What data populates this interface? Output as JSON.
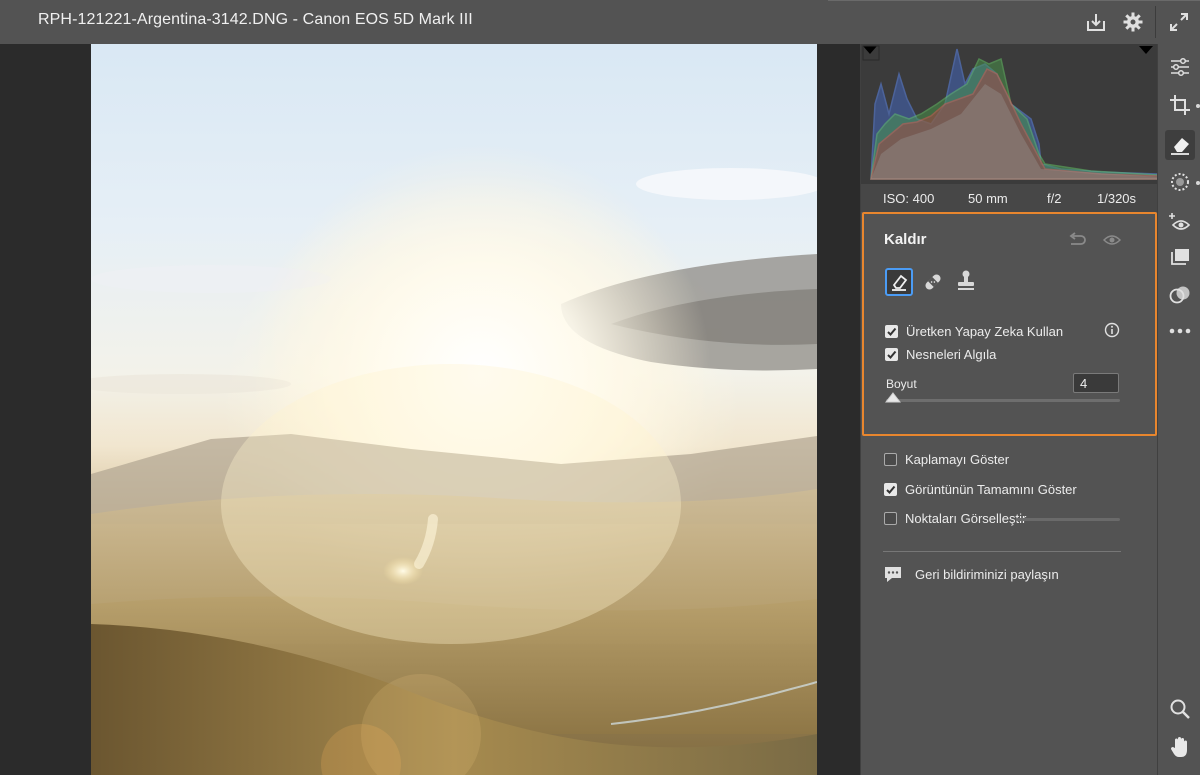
{
  "window": {
    "title": "RPH-121221-Argentina-3142.DNG  -  Canon EOS 5D Mark III"
  },
  "titlebar_icons": [
    "save-download-icon",
    "settings-gear-icon",
    "fullscreen-expand-icon"
  ],
  "exif": {
    "iso": "ISO: 400",
    "focal_length": "50 mm",
    "aperture": "f/2",
    "shutter": "1/320s"
  },
  "remove_panel": {
    "title": "Kaldır",
    "tools": [
      "eraser-icon",
      "heal-bandage-icon",
      "clone-stamp-icon"
    ],
    "use_generative_ai": {
      "label": "Üretken Yapay Zeka Kullan",
      "checked": true
    },
    "detect_objects": {
      "label": "Nesneleri Algıla",
      "checked": true
    },
    "size_label": "Boyut",
    "size_value": "4",
    "size_fraction": 0.02
  },
  "options": {
    "show_overlay": {
      "label": "Kaplamayı Göster",
      "checked": false
    },
    "show_entire_image": {
      "label": "Görüntünün Tamamını Göster",
      "checked": true
    },
    "visualize_spots": {
      "label": "Noktaları Görselleştir",
      "checked": false
    }
  },
  "feedback": {
    "label": "Geri bildiriminizi paylaşın"
  },
  "colors": {
    "accent_highlight": "#e8862e",
    "selected_tool_border": "#4b9cf5",
    "panel_bg": "#535353"
  },
  "toolbar": [
    "edit-sliders-icon",
    "crop-icon",
    "remove-eraser-icon",
    "masking-icon",
    "red-eye-icon",
    "presets-icon",
    "mixer-icon",
    "more-options-icon",
    "zoom-icon",
    "hand-icon"
  ]
}
